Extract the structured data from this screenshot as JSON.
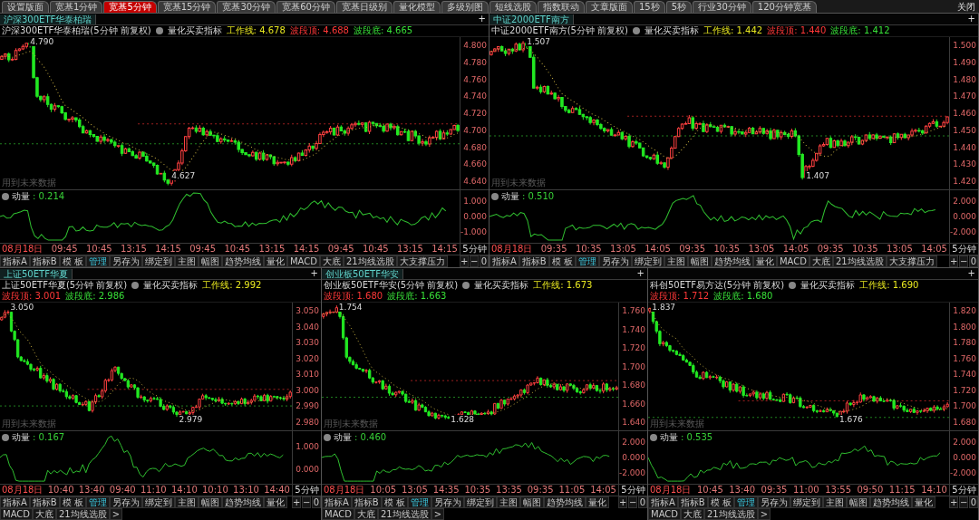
{
  "top_tabs": [
    {
      "label": "设置版面",
      "selected": false
    },
    {
      "label": "宽基1分钟",
      "selected": false
    },
    {
      "label": "宽基5分钟",
      "selected": true
    },
    {
      "label": "宽基15分钟",
      "selected": false
    },
    {
      "label": "宽基30分钟",
      "selected": false
    },
    {
      "label": "宽基60分钟",
      "selected": false
    },
    {
      "label": "宽基日级别",
      "selected": false
    },
    {
      "label": "量化模型",
      "selected": false
    },
    {
      "label": "多级别图",
      "selected": false
    },
    {
      "label": "短线选股",
      "selected": false
    },
    {
      "label": "指数联动",
      "selected": false
    },
    {
      "label": "文章版面",
      "selected": false
    },
    {
      "label": "15秒",
      "selected": false
    },
    {
      "label": "5秒",
      "selected": false
    },
    {
      "label": "行业30分钟",
      "selected": false
    },
    {
      "label": "120分钟宽基",
      "selected": false
    }
  ],
  "close_button": "关闭",
  "panels": [
    {
      "tab_label": "沪深300ETF华泰柏瑞",
      "add_button": "+",
      "title": "沪深300ETF华泰柏瑞(5分钟 前复权)",
      "indicator": "量化买卖指标",
      "work_line": "工作线: 4.678",
      "band_top": "波段顶: 4.688",
      "band_bottom": "波段底: 4.665",
      "price_ticks": [
        "4.800",
        "4.780",
        "4.760",
        "4.740",
        "4.720",
        "4.700",
        "4.680",
        "4.660",
        "4.640"
      ],
      "high_label": "4.790",
      "low_label": "4.627",
      "note": "用到未来数据",
      "momentum_label": "动量",
      "momentum_value": ": 0.214",
      "momentum_ticks": [
        "1.000",
        "0.000",
        "-1.000"
      ],
      "time_labels": [
        "08月18日",
        "09:45",
        "10:45",
        "13:15",
        "14:15",
        "09:45",
        "10:45",
        "13:15",
        "14:15",
        "09:45",
        "10:45",
        "13:15",
        "14:15"
      ],
      "period": "5分钟",
      "toolbar": [
        {
          "label": "指标A",
          "selected": false
        },
        {
          "label": "指标B",
          "selected": false
        },
        {
          "label": "模 板",
          "selected": false
        },
        {
          "label": "管理",
          "selected": true
        },
        {
          "label": "另存为",
          "selected": false
        },
        {
          "label": "绑定到",
          "selected": false
        },
        {
          "label": "主图",
          "selected": false
        },
        {
          "label": "幅图",
          "selected": false
        },
        {
          "label": "趋势均线",
          "selected": false
        },
        {
          "label": "量化",
          "selected": false
        },
        {
          "label": "MACD",
          "selected": false
        },
        {
          "label": "大底",
          "selected": false
        },
        {
          "label": "21均线选股",
          "selected": false
        },
        {
          "label": "大支撑压力",
          "selected": false
        }
      ],
      "zoom_controls": [
        "+",
        "−",
        "0"
      ]
    },
    {
      "tab_label": "中证2000ETF南方",
      "add_button": "+",
      "title": "中证2000ETF南方(5分钟 前复权)",
      "indicator": "量化买卖指标",
      "work_line": "工作线: 1.442",
      "band_top": "波段顶: 1.440",
      "band_bottom": "波段底: 1.412",
      "price_ticks": [
        "1.500",
        "1.490",
        "1.480",
        "1.470",
        "1.460",
        "1.450",
        "1.440",
        "1.430",
        "1.420"
      ],
      "high_label": "1.507",
      "low_label": "1.407",
      "note": "用到未来数据",
      "momentum_label": "动量",
      "momentum_value": ": 0.510",
      "momentum_ticks": [
        "2.000",
        "0.000",
        "-2.000"
      ],
      "time_labels": [
        "08月18日",
        "09:35",
        "10:35",
        "13:05",
        "14:05",
        "09:35",
        "10:35",
        "13:05",
        "14:05",
        "09:35",
        "10:35",
        "13:05",
        "14:05"
      ],
      "period": "5分钟",
      "toolbar": [
        {
          "label": "指标A",
          "selected": false
        },
        {
          "label": "指标B",
          "selected": false
        },
        {
          "label": "模 板",
          "selected": false
        },
        {
          "label": "管理",
          "selected": true
        },
        {
          "label": "另存为",
          "selected": false
        },
        {
          "label": "绑定到",
          "selected": false
        },
        {
          "label": "主图",
          "selected": false
        },
        {
          "label": "幅图",
          "selected": false
        },
        {
          "label": "趋势均线",
          "selected": false
        },
        {
          "label": "量化",
          "selected": false
        },
        {
          "label": "MACD",
          "selected": false
        },
        {
          "label": "大底",
          "selected": false
        },
        {
          "label": "21均线选股",
          "selected": false
        },
        {
          "label": "大支撑压力",
          "selected": false
        }
      ],
      "zoom_controls": [
        "+",
        "−",
        "0"
      ]
    },
    {
      "tab_label": "上证50ETF华夏",
      "add_button": "+",
      "title": "上证50ETF华夏(5分钟 前复权)",
      "indicator": "量化买卖指标",
      "work_line": "工作线: 2.992",
      "band_top": "波段顶: 3.001",
      "band_bottom": "波段底: 2.986",
      "price_ticks": [
        "3.050",
        "3.040",
        "3.030",
        "3.020",
        "3.010",
        "3.000",
        "2.990",
        "2.980"
      ],
      "high_label": "3.050",
      "low_label": "2.979",
      "note": "用到未来数据",
      "momentum_label": "动量",
      "momentum_value": ": 0.167",
      "momentum_ticks": [
        "1.000",
        "0.000"
      ],
      "time_labels": [
        "08月18日",
        "10:40",
        "13:40",
        "09:40",
        "11:10",
        "14:10",
        "10:10",
        "13:10",
        "14:40"
      ],
      "period": "5分钟",
      "toolbar": [
        {
          "label": "指标A",
          "selected": false
        },
        {
          "label": "指标B",
          "selected": false
        },
        {
          "label": "模 板",
          "selected": false
        },
        {
          "label": "管理",
          "selected": true
        },
        {
          "label": "另存为",
          "selected": false
        },
        {
          "label": "绑定到",
          "selected": false
        },
        {
          "label": "主图",
          "selected": false
        },
        {
          "label": "幅图",
          "selected": false
        },
        {
          "label": "趋势均线",
          "selected": false
        },
        {
          "label": "量化",
          "selected": false
        },
        {
          "label": "MACD",
          "selected": false
        },
        {
          "label": "大底",
          "selected": false
        },
        {
          "label": "21均线选股",
          "selected": false
        }
      ],
      "more_button": ">",
      "zoom_controls": [
        "+",
        "−",
        "0"
      ]
    },
    {
      "tab_label": "创业板50ETF华安",
      "add_button": "+",
      "title": "创业板50ETF华安(5分钟 前复权)",
      "indicator": "量化买卖指标",
      "work_line": "工作线: 1.673",
      "band_top": "波段顶: 1.680",
      "band_bottom": "波段底: 1.663",
      "price_ticks": [
        "1.760",
        "1.740",
        "1.720",
        "1.700",
        "1.680",
        "1.660",
        "1.640"
      ],
      "high_label": "1.754",
      "low_label": "1.628",
      "note": "用到未来数据",
      "momentum_label": "动量",
      "momentum_value": ": 0.460",
      "momentum_ticks": [
        "2.000",
        "0.000",
        "-2.000"
      ],
      "time_labels": [
        "08月18日",
        "10:05",
        "13:05",
        "14:35",
        "10:35",
        "13:35",
        "09:35",
        "11:05",
        "14:05"
      ],
      "period": "5分钟",
      "toolbar": [
        {
          "label": "指标A",
          "selected": false
        },
        {
          "label": "指标B",
          "selected": false
        },
        {
          "label": "模 板",
          "selected": false
        },
        {
          "label": "管理",
          "selected": true
        },
        {
          "label": "另存为",
          "selected": false
        },
        {
          "label": "绑定到",
          "selected": false
        },
        {
          "label": "主图",
          "selected": false
        },
        {
          "label": "幅图",
          "selected": false
        },
        {
          "label": "趋势均线",
          "selected": false
        },
        {
          "label": "量化",
          "selected": false
        },
        {
          "label": "MACD",
          "selected": false
        },
        {
          "label": "大底",
          "selected": false
        },
        {
          "label": "21均线选股",
          "selected": false
        }
      ],
      "more_button": ">",
      "zoom_controls": [
        "+",
        "−",
        "0"
      ]
    },
    {
      "add_button": "+",
      "title": "科创50ETF易方达(5分钟 前复权)",
      "indicator": "量化买卖指标",
      "work_line": "工作线: 1.690",
      "band_top": "波段顶: 1.712",
      "band_bottom": "波段底: 1.680",
      "price_ticks": [
        "1.820",
        "1.800",
        "1.780",
        "1.760",
        "1.740",
        "1.720",
        "1.700",
        "1.680"
      ],
      "high_label": "1.837",
      "low_label": "1.676",
      "note": "用到未来数据",
      "momentum_label": "动量",
      "momentum_value": ": 0.535",
      "momentum_ticks": [
        "2.000",
        "0.000",
        "-2.000"
      ],
      "time_labels": [
        "08月18日",
        "10:45",
        "13:40",
        "09:35",
        "11:00",
        "13:55",
        "09:50",
        "11:15",
        "14:10"
      ],
      "period": "5分钟",
      "toolbar": [
        {
          "label": "指标A",
          "selected": false
        },
        {
          "label": "指标B",
          "selected": false
        },
        {
          "label": "模 板",
          "selected": false
        },
        {
          "label": "管理",
          "selected": true
        },
        {
          "label": "另存为",
          "selected": false
        },
        {
          "label": "绑定到",
          "selected": false
        },
        {
          "label": "主图",
          "selected": false
        },
        {
          "label": "幅图",
          "selected": false
        },
        {
          "label": "趋势均线",
          "selected": false
        },
        {
          "label": "量化",
          "selected": false
        },
        {
          "label": "MACD",
          "selected": false
        },
        {
          "label": "大底",
          "selected": false
        },
        {
          "label": "21均线选股",
          "selected": false
        }
      ],
      "more_button": ">",
      "zoom_controls": [
        "+",
        "−",
        "0"
      ]
    }
  ]
}
